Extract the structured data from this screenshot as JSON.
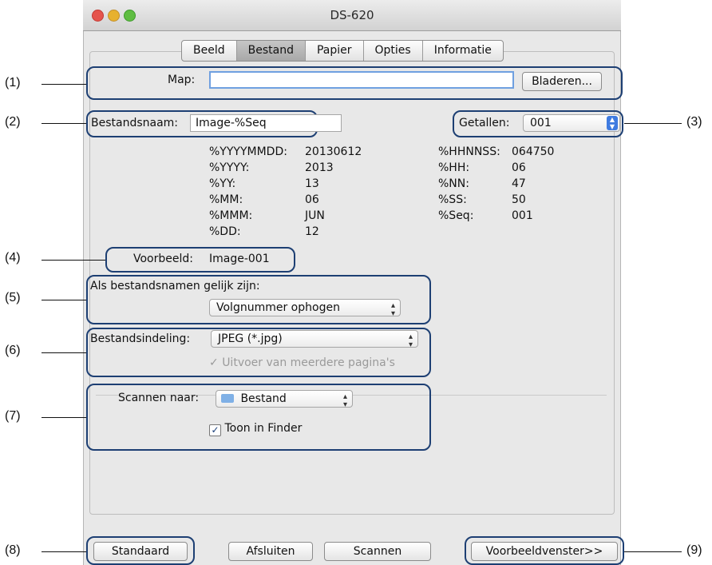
{
  "window": {
    "title": "DS-620"
  },
  "tabs": [
    "Beeld",
    "Bestand",
    "Papier",
    "Opties",
    "Informatie"
  ],
  "folder": {
    "label": "Map:",
    "value": "",
    "browse_label": "Bladeren..."
  },
  "filename": {
    "label": "Bestandsnaam:",
    "value": "Image-%Seq"
  },
  "numbers": {
    "label": "Getallen:",
    "value": "001"
  },
  "tokens_left": [
    {
      "key": "%YYYYMMDD:",
      "value": "20130612"
    },
    {
      "key": "%YYYY:",
      "value": "2013"
    },
    {
      "key": "%YY:",
      "value": "13"
    },
    {
      "key": "%MM:",
      "value": "06"
    },
    {
      "key": "%MMM:",
      "value": "JUN"
    },
    {
      "key": "%DD:",
      "value": "12"
    }
  ],
  "tokens_right": [
    {
      "key": "%HHNNSS:",
      "value": "064750"
    },
    {
      "key": "%HH:",
      "value": "06"
    },
    {
      "key": "%NN:",
      "value": "47"
    },
    {
      "key": "%SS:",
      "value": "50"
    },
    {
      "key": "%Seq:",
      "value": "001"
    }
  ],
  "preview": {
    "label": "Voorbeeld:",
    "value": "Image-001"
  },
  "duplicate": {
    "label": "Als bestandsnamen gelijk zijn:",
    "value": "Volgnummer ophogen"
  },
  "format": {
    "label": "Bestandsindeling:",
    "value": "JPEG (*.jpg)",
    "multipage_label": "Uitvoer van meerdere pagina's",
    "multipage_checked": true
  },
  "scan_to": {
    "label": "Scannen naar:",
    "value": "Bestand",
    "finder_label": "Toon in Finder",
    "finder_checked": true
  },
  "buttons": {
    "default": "Standaard",
    "close": "Afsluiten",
    "scan": "Scannen",
    "preview": "Voorbeeldvenster>>"
  },
  "callouts": [
    "(1)",
    "(2)",
    "(3)",
    "(4)",
    "(5)",
    "(6)",
    "(7)",
    "(8)",
    "(9)"
  ],
  "colors": {
    "highlight": "#1d3f73",
    "window_bg": "#e8e8e8"
  }
}
